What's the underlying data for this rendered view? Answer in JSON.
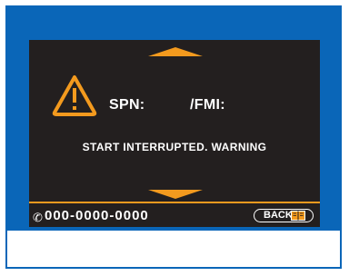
{
  "screen": {
    "spn_label": "SPN:",
    "fmi_label": "/FMI:",
    "message": "START INTERRUPTED. WARNING",
    "phone": "000-0000-0000",
    "back_label": "BACK"
  },
  "icons": {
    "warning": "warning-triangle-icon",
    "phone": "phone-icon",
    "manual": "book-icon",
    "scroll_up": "arrow-up-icon",
    "scroll_down": "arrow-down-icon"
  },
  "colors": {
    "frame_blue": "#0a66b8",
    "screen_bg": "#231f1f",
    "accent_orange": "#f39a1e",
    "text": "#ffffff"
  }
}
